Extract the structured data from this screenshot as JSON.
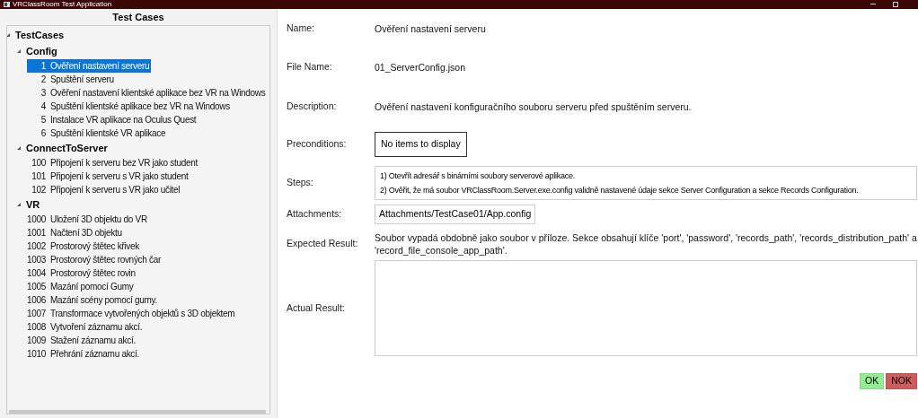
{
  "window": {
    "title": "VRClassRoom Test Application"
  },
  "tree": {
    "header": "Test Cases",
    "items": [
      {
        "label": "TestCases",
        "expanded": true,
        "children": [
          {
            "label": "Config",
            "expanded": true,
            "children": [
              {
                "number": "1",
                "label": "Ověření nastavení serveru",
                "selected": true
              },
              {
                "number": "2",
                "label": "Spuštění serveru",
                "selected": false
              },
              {
                "number": "3",
                "label": "Ověření nastavení klientské aplikace bez VR na Windows",
                "selected": false
              },
              {
                "number": "4",
                "label": "Spuštění klientské aplikace bez VR na Windows",
                "selected": false
              },
              {
                "number": "5",
                "label": "Instalace VR aplikace na Oculus Quest",
                "selected": false
              },
              {
                "number": "6",
                "label": "Spuštění klientské VR aplikace",
                "selected": false
              }
            ]
          },
          {
            "label": "ConnectToServer",
            "expanded": true,
            "children": [
              {
                "number": "100",
                "label": "Připojení k serveru bez VR jako student",
                "selected": false
              },
              {
                "number": "101",
                "label": "Připojení k serveru s VR jako student",
                "selected": false
              },
              {
                "number": "102",
                "label": "Připojení k serveru s VR jako učitel",
                "selected": false
              }
            ]
          },
          {
            "label": "VR",
            "expanded": true,
            "children": [
              {
                "number": "1000",
                "label": "Uložení 3D objektu do VR",
                "selected": false
              },
              {
                "number": "1001",
                "label": "Načtení 3D objektu",
                "selected": false
              },
              {
                "number": "1002",
                "label": "Prostorový štětec křivek",
                "selected": false
              },
              {
                "number": "1003",
                "label": "Prostorový štětec rovných čar",
                "selected": false
              },
              {
                "number": "1004",
                "label": "Prostorový štětec rovin",
                "selected": false
              },
              {
                "number": "1005",
                "label": "Mazání pomocí Gumy",
                "selected": false
              },
              {
                "number": "1006",
                "label": "Mazání scény pomocí gumy.",
                "selected": false
              },
              {
                "number": "1007",
                "label": "Transformace vytvořených objektů s 3D objektem",
                "selected": false
              },
              {
                "number": "1008",
                "label": "Vytvoření záznamu akcí.",
                "selected": false
              },
              {
                "number": "1009",
                "label": "Stažení záznamu akcí.",
                "selected": false
              },
              {
                "number": "1010",
                "label": "Přehrání záznamu akcí.",
                "selected": false
              }
            ]
          }
        ]
      }
    ]
  },
  "details": [
    {
      "kind": "text",
      "label": "Name:",
      "value": "Ověření nastavení serveru"
    },
    {
      "kind": "text",
      "label": "File Name:",
      "value": "01_ServerConfig.json"
    },
    {
      "kind": "text",
      "label": "Description:",
      "value": "Ověření nastavení konfiguračního souboru serveru před spuštěním serveru."
    },
    {
      "kind": "empty",
      "label": "Preconditions:",
      "value": "No items to display"
    },
    {
      "kind": "list",
      "label": "Steps:",
      "items": [
        "1)  Otevřít adresář s binárními soubory serverové aplikace.",
        "2)  Ověřit, že má soubor VRClassRoom.Server.exe.config validně nastavené údaje sekce Server Configuration a sekce Records Configuration."
      ]
    },
    {
      "kind": "file",
      "label": "Attachments:",
      "value": "Attachments/TestCase01/App.config"
    },
    {
      "kind": "text",
      "label": "Expected Result:",
      "value": "Soubor vypadá obdobně jako soubor v příloze. Sekce obsahují klíče 'port', 'password', 'records_path', 'records_distribution_path' a 'record_file_console_app_path'."
    },
    {
      "kind": "input",
      "label": "Actual Result:"
    }
  ],
  "buttons": [
    {
      "kind": "ok",
      "label": "OK"
    },
    {
      "kind": "nok",
      "label": "NOK"
    }
  ]
}
